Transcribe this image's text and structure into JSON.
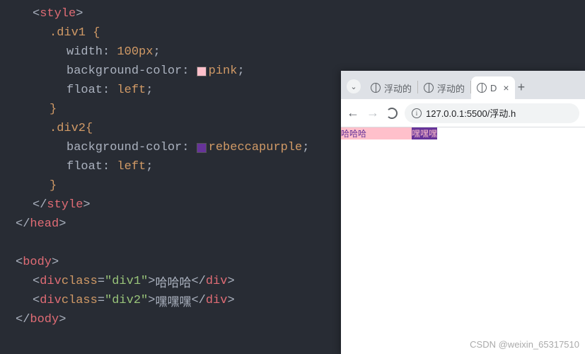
{
  "code": {
    "style": "style",
    "div1_sel": ".div1 {",
    "width_prop": "width",
    "width_val": "100px",
    "bg_prop": "background-color",
    "pink": "pink",
    "float_prop": "float",
    "float_val": "left",
    "brace_close": "}",
    "div2_sel": ".div2{",
    "rebecca": "rebeccapurple",
    "head": "head",
    "body": "body",
    "div": "div",
    "class_attr": "class",
    "div1_val": "\"div1\"",
    "div2_val": "\"div2\"",
    "text1": "哈哈哈",
    "text2": "嘿嘿嘿"
  },
  "browser": {
    "tabs": [
      {
        "label": "浮动的"
      },
      {
        "label": "浮动的"
      },
      {
        "label": "D"
      }
    ],
    "url": "127.0.0.1:5500/浮动.h",
    "page": {
      "div1_text": "哈哈哈",
      "div2_text": "嘿嘿嘿"
    }
  },
  "watermark": "CSDN @weixin_65317510"
}
